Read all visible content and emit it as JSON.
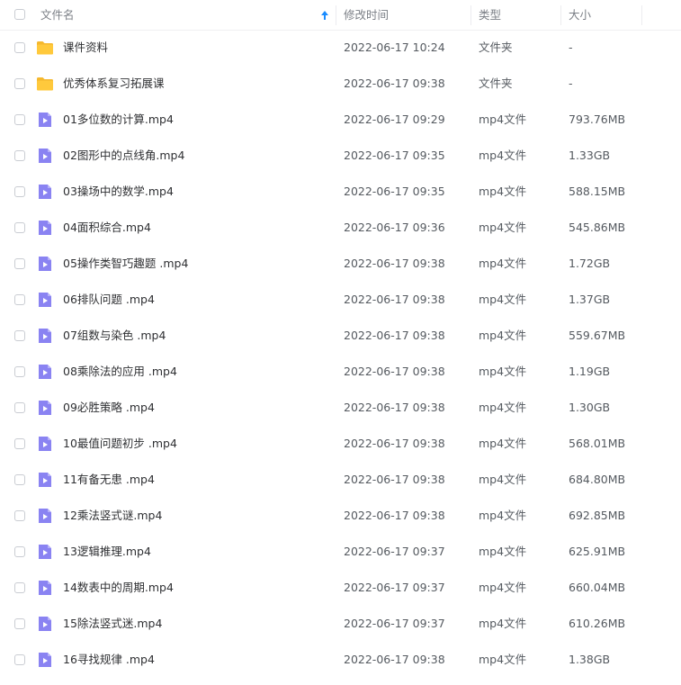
{
  "header": {
    "name": "文件名",
    "time": "修改时间",
    "type": "类型",
    "size": "大小",
    "sort_icon": "sort-up-arrow-icon"
  },
  "colors": {
    "folder": "#ffc93c",
    "video_icon": "#8a83f2",
    "sort_arrow": "#1a8cff"
  },
  "rows": [
    {
      "kind": "folder",
      "name": "课件资料",
      "time": "2022-06-17 10:24",
      "type": "文件夹",
      "size": "-"
    },
    {
      "kind": "folder",
      "name": "优秀体系复习拓展课",
      "time": "2022-06-17 09:38",
      "type": "文件夹",
      "size": "-"
    },
    {
      "kind": "video",
      "name": "01多位数的计算.mp4",
      "time": "2022-06-17 09:29",
      "type": "mp4文件",
      "size": "793.76MB"
    },
    {
      "kind": "video",
      "name": "02图形中的点线角.mp4",
      "time": "2022-06-17 09:35",
      "type": "mp4文件",
      "size": "1.33GB"
    },
    {
      "kind": "video",
      "name": "03操场中的数学.mp4",
      "time": "2022-06-17 09:35",
      "type": "mp4文件",
      "size": "588.15MB"
    },
    {
      "kind": "video",
      "name": "04面积综合.mp4",
      "time": "2022-06-17 09:36",
      "type": "mp4文件",
      "size": "545.86MB"
    },
    {
      "kind": "video",
      "name": "05操作类智巧趣题 .mp4",
      "time": "2022-06-17 09:38",
      "type": "mp4文件",
      "size": "1.72GB"
    },
    {
      "kind": "video",
      "name": "06排队问题 .mp4",
      "time": "2022-06-17 09:38",
      "type": "mp4文件",
      "size": "1.37GB"
    },
    {
      "kind": "video",
      "name": "07组数与染色 .mp4",
      "time": "2022-06-17 09:38",
      "type": "mp4文件",
      "size": "559.67MB"
    },
    {
      "kind": "video",
      "name": "08乘除法的应用 .mp4",
      "time": "2022-06-17 09:38",
      "type": "mp4文件",
      "size": "1.19GB"
    },
    {
      "kind": "video",
      "name": "09必胜策略 .mp4",
      "time": "2022-06-17 09:38",
      "type": "mp4文件",
      "size": "1.30GB"
    },
    {
      "kind": "video",
      "name": "10最值问题初步 .mp4",
      "time": "2022-06-17 09:38",
      "type": "mp4文件",
      "size": "568.01MB"
    },
    {
      "kind": "video",
      "name": "11有备无患 .mp4",
      "time": "2022-06-17 09:38",
      "type": "mp4文件",
      "size": "684.80MB"
    },
    {
      "kind": "video",
      "name": "12乘法竖式谜.mp4",
      "time": "2022-06-17 09:38",
      "type": "mp4文件",
      "size": "692.85MB"
    },
    {
      "kind": "video",
      "name": "13逻辑推理.mp4",
      "time": "2022-06-17 09:37",
      "type": "mp4文件",
      "size": "625.91MB"
    },
    {
      "kind": "video",
      "name": "14数表中的周期.mp4",
      "time": "2022-06-17 09:37",
      "type": "mp4文件",
      "size": "660.04MB"
    },
    {
      "kind": "video",
      "name": "15除法竖式迷.mp4",
      "time": "2022-06-17 09:37",
      "type": "mp4文件",
      "size": "610.26MB"
    },
    {
      "kind": "video",
      "name": "16寻找规律 .mp4",
      "time": "2022-06-17 09:38",
      "type": "mp4文件",
      "size": "1.38GB"
    }
  ]
}
